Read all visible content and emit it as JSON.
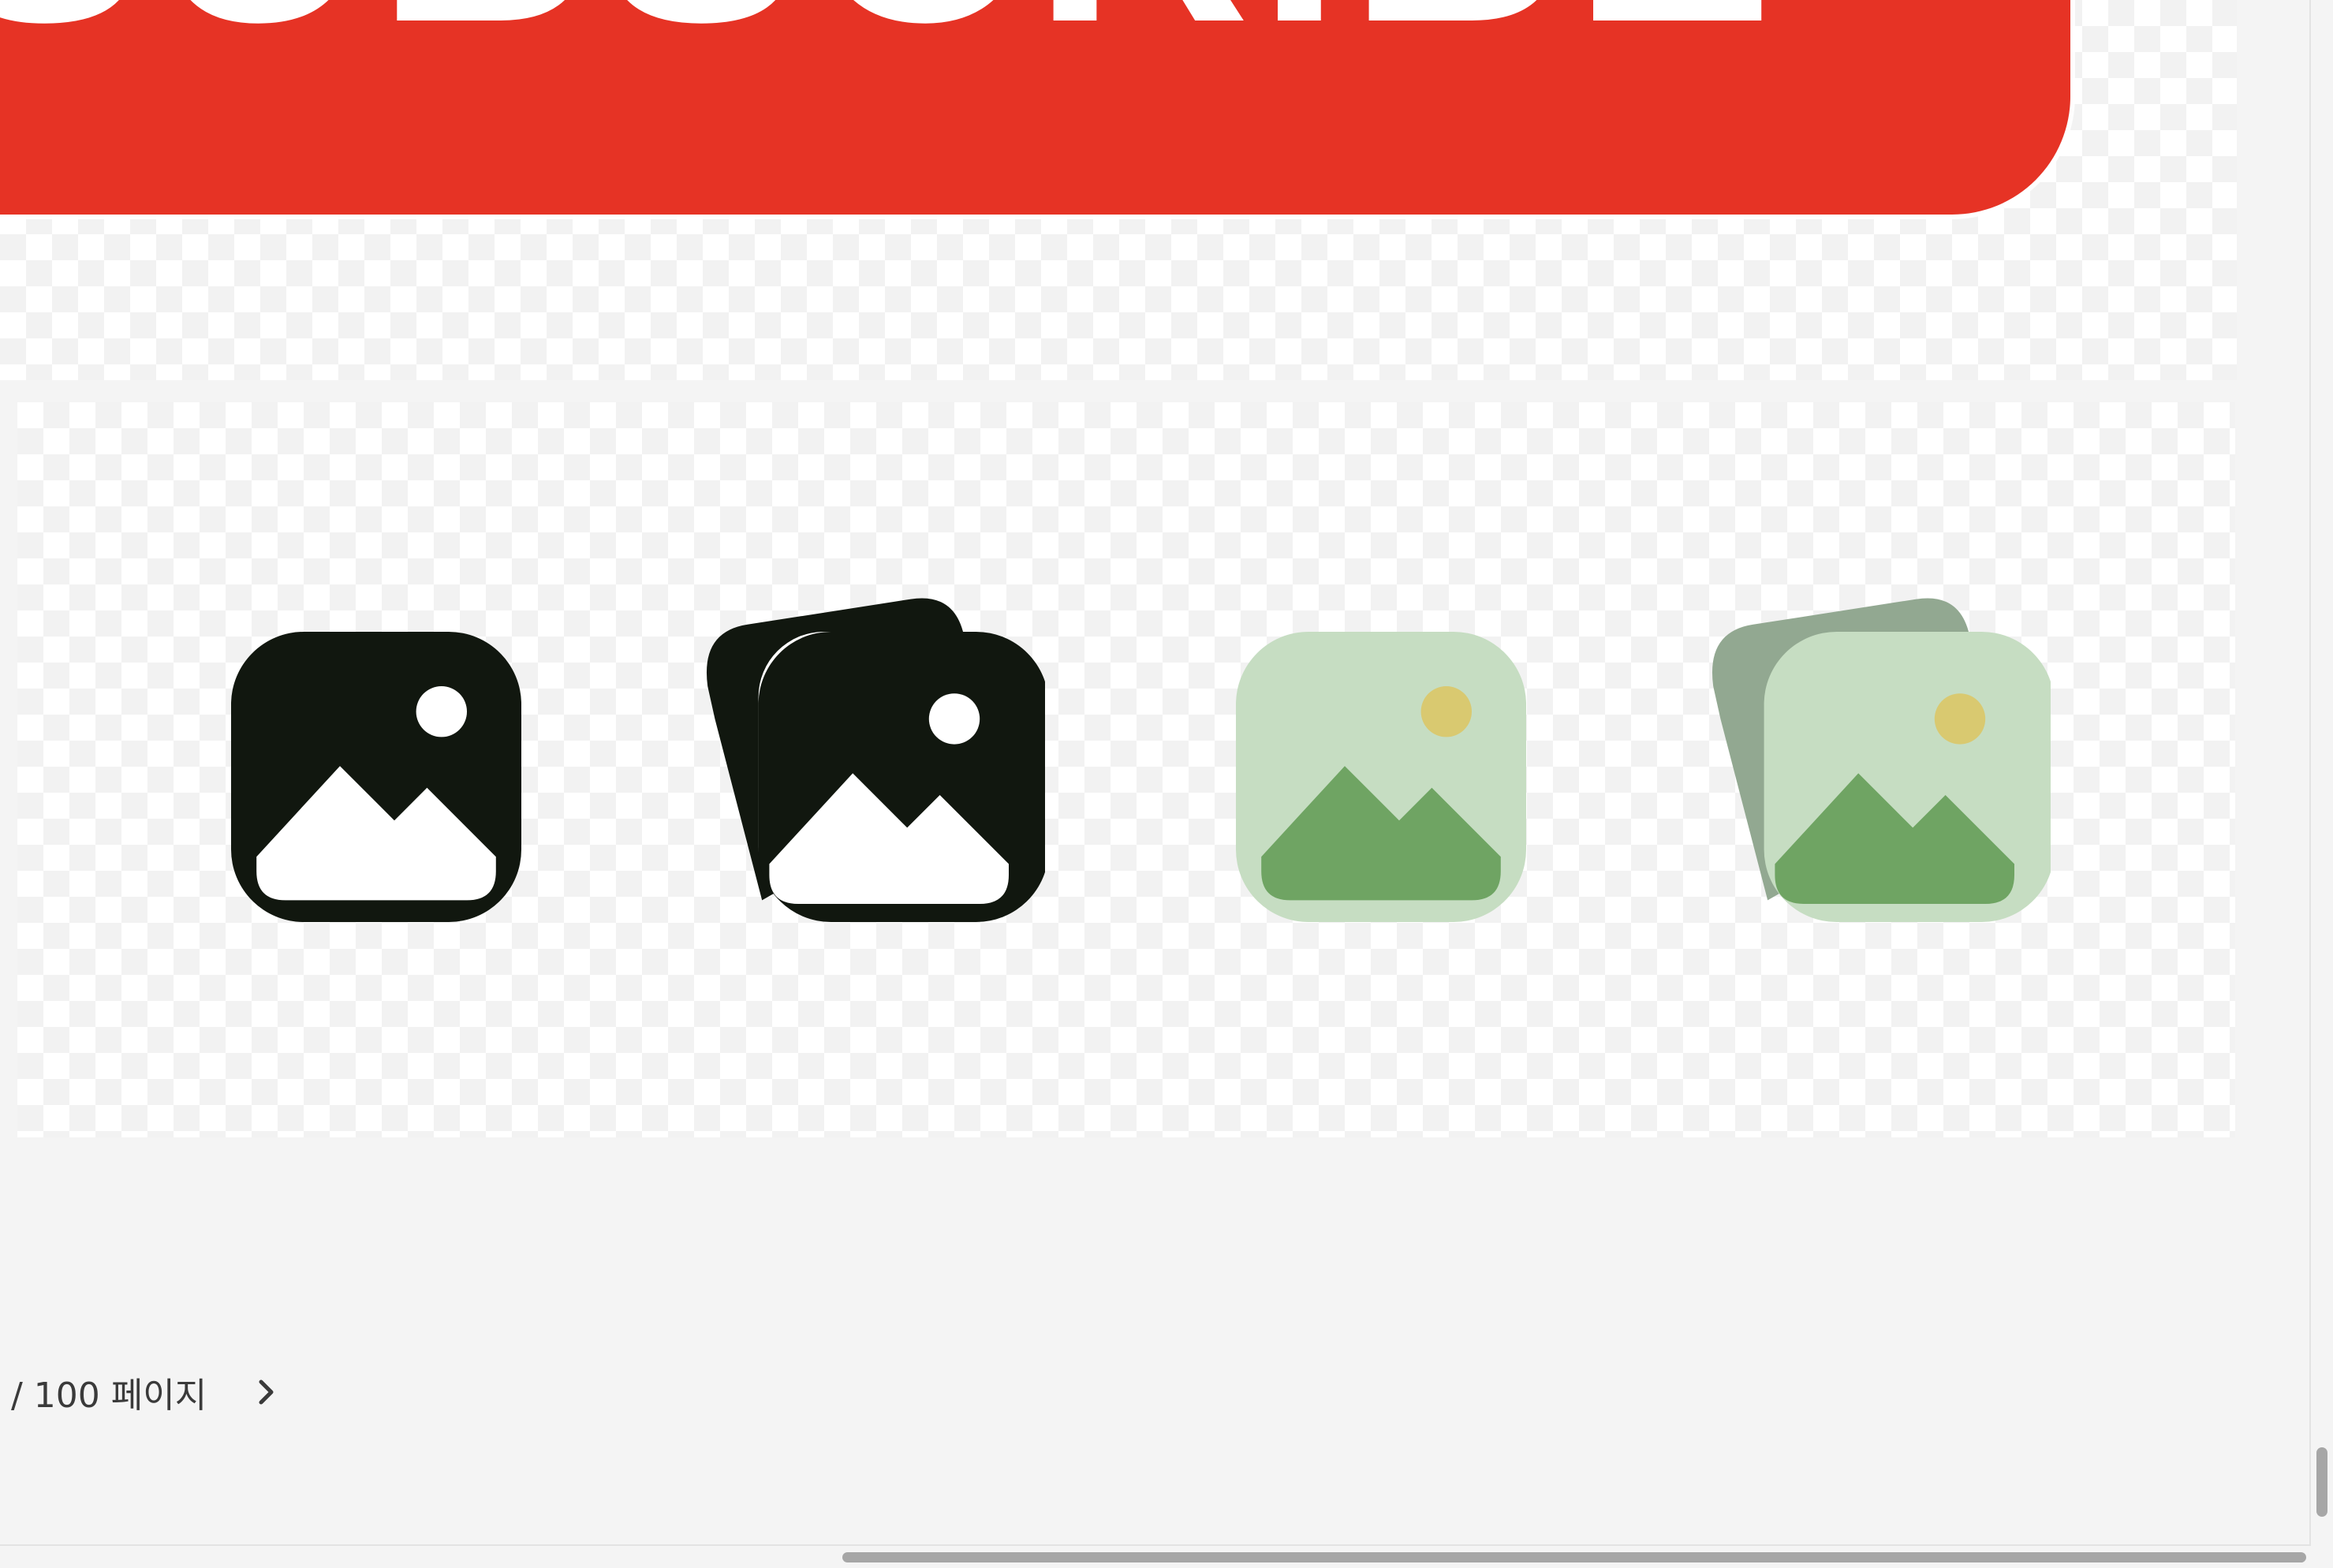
{
  "banner": {
    "text": "SUBSCRIBE",
    "color": "#e63325"
  },
  "icons": [
    {
      "name": "image-icon",
      "style": "filled-dark"
    },
    {
      "name": "images-stack-icon",
      "style": "filled-dark"
    },
    {
      "name": "image-icon",
      "style": "color-green"
    },
    {
      "name": "images-stack-icon",
      "style": "color-green"
    }
  ],
  "colors": {
    "dark": "#11170f",
    "green_light": "#c6ddc2",
    "green_dark": "#6fa463",
    "green_back": "#92a891",
    "sun": "#d9c970"
  },
  "pager": {
    "label": "/ 100 페이지",
    "next_icon": "chevron-right-icon"
  }
}
